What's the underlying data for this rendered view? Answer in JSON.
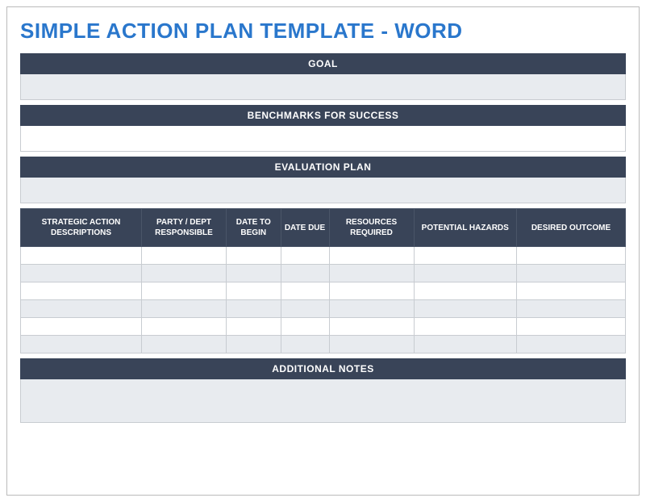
{
  "title": "SIMPLE ACTION PLAN TEMPLATE - WORD",
  "sections": {
    "goal": {
      "label": "GOAL",
      "value": ""
    },
    "benchmarks": {
      "label": "BENCHMARKS FOR SUCCESS",
      "value": ""
    },
    "evaluation": {
      "label": "EVALUATION PLAN",
      "value": ""
    },
    "notes": {
      "label": "ADDITIONAL NOTES",
      "value": ""
    }
  },
  "table": {
    "headers": {
      "description": "STRATEGIC ACTION DESCRIPTIONS",
      "party": "PARTY / DEPT RESPONSIBLE",
      "begin": "DATE TO BEGIN",
      "due": "DATE DUE",
      "resources": "RESOURCES REQUIRED",
      "hazards": "POTENTIAL HAZARDS",
      "outcome": "DESIRED OUTCOME"
    },
    "rows": [
      {
        "description": "",
        "party": "",
        "begin": "",
        "due": "",
        "resources": "",
        "hazards": "",
        "outcome": ""
      },
      {
        "description": "",
        "party": "",
        "begin": "",
        "due": "",
        "resources": "",
        "hazards": "",
        "outcome": ""
      },
      {
        "description": "",
        "party": "",
        "begin": "",
        "due": "",
        "resources": "",
        "hazards": "",
        "outcome": ""
      },
      {
        "description": "",
        "party": "",
        "begin": "",
        "due": "",
        "resources": "",
        "hazards": "",
        "outcome": ""
      },
      {
        "description": "",
        "party": "",
        "begin": "",
        "due": "",
        "resources": "",
        "hazards": "",
        "outcome": ""
      },
      {
        "description": "",
        "party": "",
        "begin": "",
        "due": "",
        "resources": "",
        "hazards": "",
        "outcome": ""
      }
    ]
  }
}
